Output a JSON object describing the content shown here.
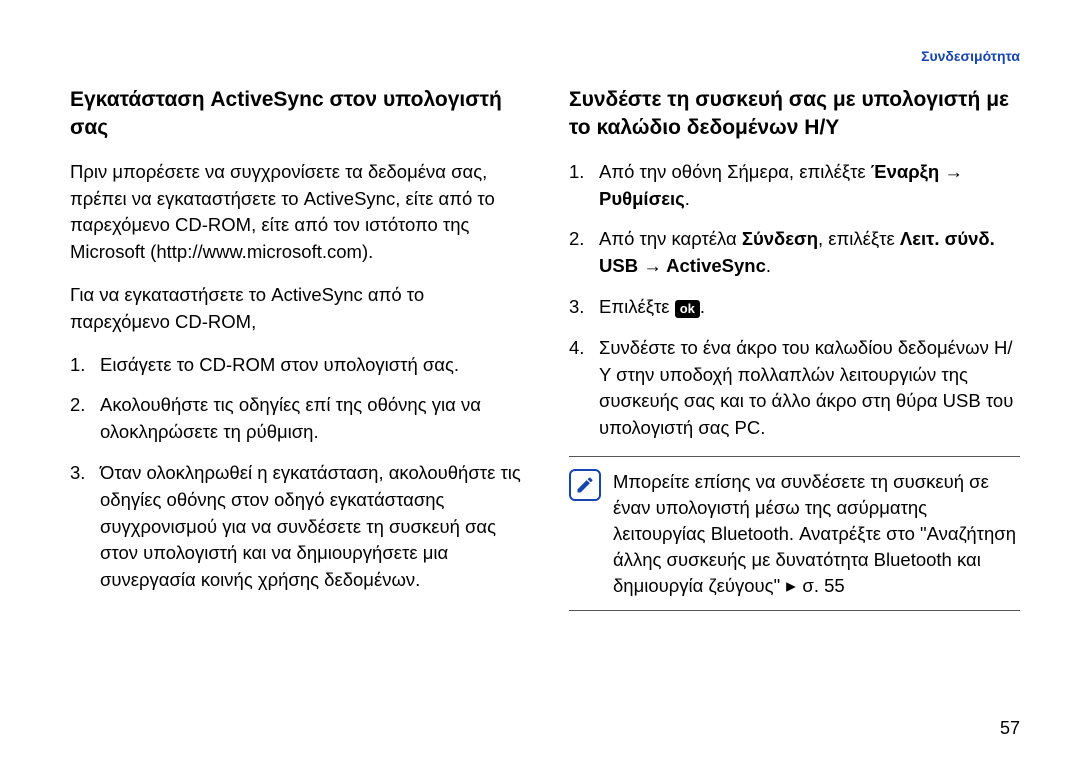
{
  "header": {
    "breadcrumb": "Συνδεσιμότητα"
  },
  "left": {
    "title": "Εγκατάσταση ActiveSync στον υπολογιστή σας",
    "p1": "Πριν μπορέσετε να συγχρονίσετε τα δεδομένα σας, πρέπει να εγκαταστήσετε το ActiveSync, είτε από το παρεχόμενο CD-ROM, είτε από τον ιστότοπο της Microsoft (http://www.microsoft.com).",
    "p2": "Για να εγκαταστήσετε το ActiveSync από το παρεχόμενο CD-ROM,",
    "list": [
      {
        "n": "1.",
        "t": "Εισάγετε το CD-ROM στον υπολογιστή σας."
      },
      {
        "n": "2.",
        "t": "Ακολουθήστε τις οδηγίες επί της οθόνης για να ολοκληρώσετε τη ρύθμιση."
      },
      {
        "n": "3.",
        "t": "Όταν ολοκληρωθεί η εγκατάσταση, ακολουθήστε τις οδηγίες οθόνης στον οδηγό εγκατάστασης συγχρονισμού για να συνδέσετε τη συσκευή σας στον υπολογιστή και να δημιουργήσετε μια συνεργασία κοινής χρήσης δεδομένων."
      }
    ]
  },
  "right": {
    "title": "Συνδέστε τη συσκευή σας με υπολογιστή με το καλώδιο δεδομένων Η/Υ",
    "list": [
      {
        "n": "1.",
        "pre": "Από την οθόνη Σήμερα, επιλέξτε ",
        "b1": "Έναρξη",
        "arrow": " → ",
        "b2": "Ρυθμίσεις",
        "post": "."
      },
      {
        "n": "2.",
        "pre": "Από την καρτέλα ",
        "b1": "Σύνδεση",
        "mid": ", επιλέξτε ",
        "b2": "Λειτ. σύνδ. USB",
        "arrow": " → ",
        "b3": "ActiveSync",
        "post": "."
      },
      {
        "n": "3.",
        "pre": "Επιλέξτε ",
        "ok": "ok",
        "post": "."
      },
      {
        "n": "4.",
        "t": "Συνδέστε το ένα άκρο του καλωδίου δεδομένων Η/Υ στην υποδοχή πολλαπλών λειτουργιών της συσκευής σας και το άλλο άκρο στη θύρα USB του υπολογιστή σας PC."
      }
    ],
    "note": {
      "text_pre": "Μπορείτε επίσης να συνδέσετε τη συσκευή σε έναν υπολογιστή μέσω της ασύρματης λειτουργίας Bluetooth. Ανατρέξτε στο \"Αναζήτηση άλλης συσκευής με δυνατότητα Bluetooth και δημιουργία ζεύγους\" ",
      "page_ref": "σ. 55"
    }
  },
  "page_number": "57"
}
